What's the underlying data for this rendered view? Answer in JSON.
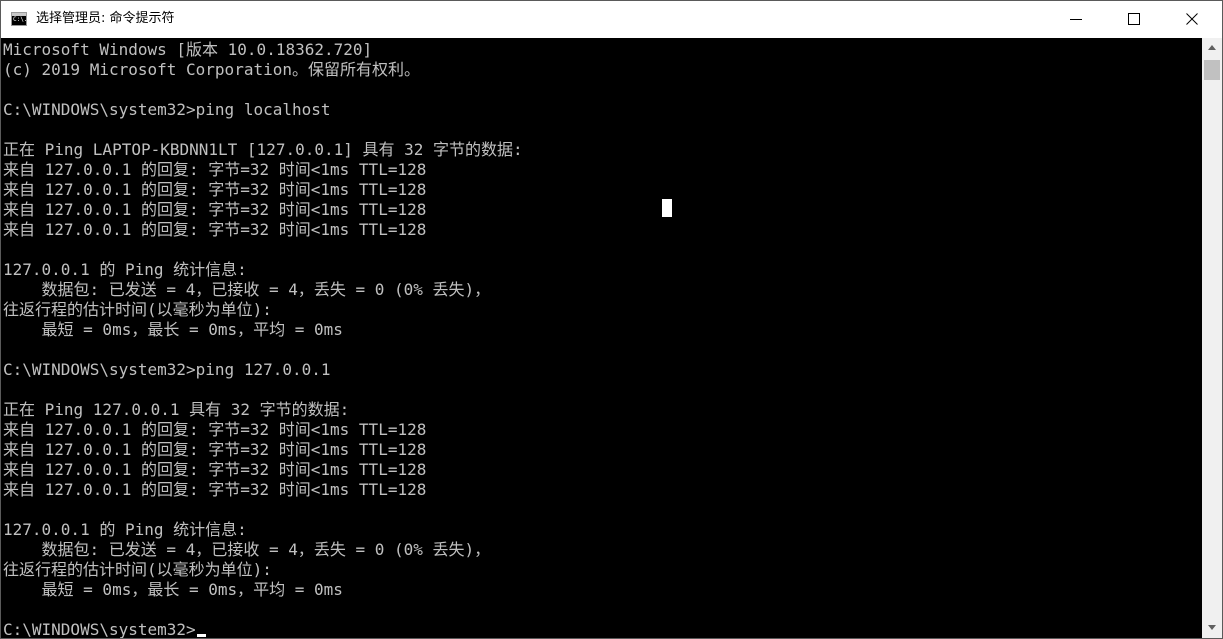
{
  "window": {
    "title": "选择管理员: 命令提示符",
    "icon_name": "cmd-icon",
    "icon_text": "C:\\."
  },
  "console": {
    "foreground": "#c0c0c0",
    "background": "#000000",
    "lines": [
      "Microsoft Windows [版本 10.0.18362.720]",
      "(c) 2019 Microsoft Corporation。保留所有权利。",
      "",
      "C:\\WINDOWS\\system32>ping localhost",
      "",
      "正在 Ping LAPTOP-KBDNN1LT [127.0.0.1] 具有 32 字节的数据:",
      "来自 127.0.0.1 的回复: 字节=32 时间<1ms TTL=128",
      "来自 127.0.0.1 的回复: 字节=32 时间<1ms TTL=128",
      "来自 127.0.0.1 的回复: 字节=32 时间<1ms TTL=128",
      "来自 127.0.0.1 的回复: 字节=32 时间<1ms TTL=128",
      "",
      "127.0.0.1 的 Ping 统计信息:",
      "    数据包: 已发送 = 4，已接收 = 4，丢失 = 0 (0% 丢失)，",
      "往返行程的估计时间(以毫秒为单位):",
      "    最短 = 0ms，最长 = 0ms，平均 = 0ms",
      "",
      "C:\\WINDOWS\\system32>ping 127.0.0.1",
      "",
      "正在 Ping 127.0.0.1 具有 32 字节的数据:",
      "来自 127.0.0.1 的回复: 字节=32 时间<1ms TTL=128",
      "来自 127.0.0.1 的回复: 字节=32 时间<1ms TTL=128",
      "来自 127.0.0.1 的回复: 字节=32 时间<1ms TTL=128",
      "来自 127.0.0.1 的回复: 字节=32 时间<1ms TTL=128",
      "",
      "127.0.0.1 的 Ping 统计信息:",
      "    数据包: 已发送 = 4，已接收 = 4，丢失 = 0 (0% 丢失)，",
      "往返行程的估计时间(以毫秒为单位):",
      "    最短 = 0ms，最长 = 0ms，平均 = 0ms",
      "",
      "C:\\WINDOWS\\system32>"
    ]
  },
  "controls": {
    "minimize_icon": "minimize-icon",
    "maximize_icon": "maximize-icon",
    "close_icon": "close-icon"
  }
}
